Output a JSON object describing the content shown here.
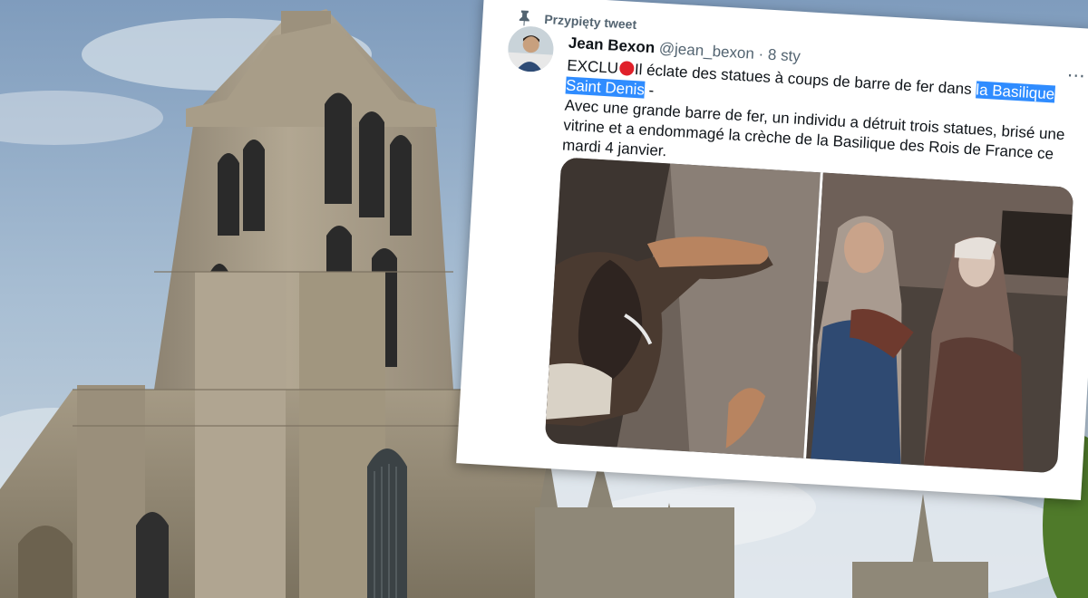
{
  "tweet": {
    "pinned_label": "Przypięty tweet",
    "author_name": "Jean Bexon",
    "author_handle": "@jean_bexon",
    "separator": "·",
    "date": "8 sty",
    "text_part1": "EXCLU",
    "text_part2": "Il éclate des statues à coups de barre de fer dans ",
    "text_highlight": "la Basilique Saint Denis",
    "text_part3": " -",
    "text_paragraph2": "Avec une grande barre de fer, un individu a détruit trois statues, brisé une vitrine et a endommagé la crèche de la Basilique des Rois de France ce mardi 4 janvier."
  },
  "colors": {
    "highlight": "#2f8cff",
    "record_dot": "#e0202a",
    "secondary_text": "#536471"
  },
  "icons": {
    "pin": "pin-icon",
    "more": "more-icon",
    "record": "red-circle-icon"
  }
}
